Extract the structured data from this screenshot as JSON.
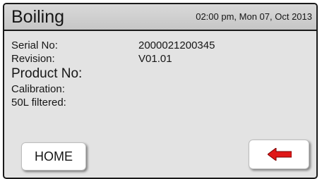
{
  "header": {
    "title": "Boiling",
    "datetime": "02:00 pm, Mon 07, Oct 2013"
  },
  "info": {
    "serial_label": "Serial No:",
    "serial_value": "2000021200345",
    "revision_label": "Revision:",
    "revision_value": "V01.01",
    "product_label": "Product No:",
    "calibration_label": "Calibration:",
    "filtered_label": "50L filtered:"
  },
  "buttons": {
    "home_label": "HOME",
    "back_icon": "left-arrow-icon",
    "back_icon_color": "#e01818"
  }
}
